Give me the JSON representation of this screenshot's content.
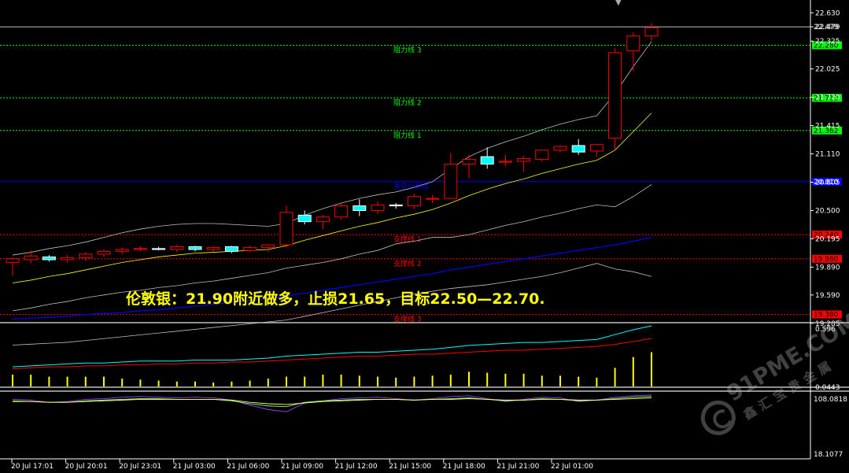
{
  "headline": "伦敦银：21.90附近做多，止损21.65，目标22.50—22.70.",
  "watermark": {
    "brand": "91PME.COM",
    "tagline": "鑫汇宝贵金属"
  },
  "colors": {
    "background": "#000000",
    "axis": "#ffffff",
    "bull_body": "#000000",
    "bull_border": "#ff0000",
    "bear_body": "#00ffff",
    "bear_border": "#ffffff",
    "resistance": "#00ff00",
    "support": "#ff0000",
    "pivot": "#0000ff",
    "ma_fast": "#ffff00",
    "band": "#c0c0c0",
    "blue_ma": "#0000ff",
    "volume_bar": "#ffff00",
    "vol_line_1": "#00ffff",
    "vol_line_2": "#ff0000"
  },
  "chart_data": [
    {
      "type": "candlestick",
      "panel": "price",
      "title": "",
      "ylim": [
        19.3,
        22.7
      ],
      "y_ticks": [
        "22.630",
        "22.479",
        "22.325",
        "22.025",
        "21.720",
        "21.415",
        "21.110",
        "20.805",
        "20.500",
        "20.195",
        "19.890",
        "19.590",
        "19.285"
      ],
      "time_labels": [
        "20 Jul 17:01",
        "20 Jul 20:01",
        "20 Jul 23:01",
        "21 Jul 03:00",
        "21 Jul 06:00",
        "21 Jul 09:00",
        "21 Jul 12:00",
        "21 Jul 15:00",
        "21 Jul 18:00",
        "21 Jul 21:00",
        "22 Jul 01:00"
      ],
      "candles": [
        {
          "o": 19.94,
          "h": 20.0,
          "l": 19.8,
          "c": 19.98
        },
        {
          "o": 19.97,
          "h": 20.07,
          "l": 19.93,
          "c": 20.01
        },
        {
          "o": 20.0,
          "h": 20.02,
          "l": 19.95,
          "c": 19.97
        },
        {
          "o": 19.97,
          "h": 20.02,
          "l": 19.94,
          "c": 19.99
        },
        {
          "o": 19.99,
          "h": 20.05,
          "l": 19.96,
          "c": 20.03
        },
        {
          "o": 20.03,
          "h": 20.08,
          "l": 20.0,
          "c": 20.06
        },
        {
          "o": 20.06,
          "h": 20.1,
          "l": 20.03,
          "c": 20.08
        },
        {
          "o": 20.08,
          "h": 20.11,
          "l": 20.06,
          "c": 20.09
        },
        {
          "o": 20.09,
          "h": 20.11,
          "l": 20.07,
          "c": 20.08
        },
        {
          "o": 20.08,
          "h": 20.13,
          "l": 20.05,
          "c": 20.11
        },
        {
          "o": 20.11,
          "h": 20.12,
          "l": 20.06,
          "c": 20.08
        },
        {
          "o": 20.08,
          "h": 20.11,
          "l": 20.06,
          "c": 20.1
        },
        {
          "o": 20.11,
          "h": 20.12,
          "l": 20.04,
          "c": 20.06
        },
        {
          "o": 20.07,
          "h": 20.12,
          "l": 20.05,
          "c": 20.1
        },
        {
          "o": 20.1,
          "h": 20.14,
          "l": 20.05,
          "c": 20.13
        },
        {
          "o": 20.13,
          "h": 20.55,
          "l": 20.1,
          "c": 20.48
        },
        {
          "o": 20.45,
          "h": 20.5,
          "l": 20.35,
          "c": 20.38
        },
        {
          "o": 20.38,
          "h": 20.45,
          "l": 20.3,
          "c": 20.43
        },
        {
          "o": 20.43,
          "h": 20.58,
          "l": 20.4,
          "c": 20.55
        },
        {
          "o": 20.55,
          "h": 20.62,
          "l": 20.44,
          "c": 20.5
        },
        {
          "o": 20.5,
          "h": 20.6,
          "l": 20.46,
          "c": 20.56
        },
        {
          "o": 20.56,
          "h": 20.58,
          "l": 20.52,
          "c": 20.55
        },
        {
          "o": 20.55,
          "h": 20.68,
          "l": 20.52,
          "c": 20.65
        },
        {
          "o": 20.63,
          "h": 20.67,
          "l": 20.58,
          "c": 20.63
        },
        {
          "o": 20.63,
          "h": 21.12,
          "l": 20.65,
          "c": 21.0
        },
        {
          "o": 21.0,
          "h": 21.1,
          "l": 20.85,
          "c": 21.05
        },
        {
          "o": 21.08,
          "h": 21.18,
          "l": 20.95,
          "c": 21.0
        },
        {
          "o": 21.02,
          "h": 21.1,
          "l": 20.98,
          "c": 21.03
        },
        {
          "o": 21.03,
          "h": 21.09,
          "l": 20.92,
          "c": 21.06
        },
        {
          "o": 21.05,
          "h": 21.15,
          "l": 21.03,
          "c": 21.15
        },
        {
          "o": 21.15,
          "h": 21.2,
          "l": 21.13,
          "c": 21.19
        },
        {
          "o": 21.2,
          "h": 21.27,
          "l": 21.1,
          "c": 21.13
        },
        {
          "o": 21.14,
          "h": 21.22,
          "l": 21.08,
          "c": 21.21
        },
        {
          "o": 21.28,
          "h": 22.25,
          "l": 21.15,
          "c": 22.2
        },
        {
          "o": 22.22,
          "h": 22.42,
          "l": 22.0,
          "c": 22.38
        },
        {
          "o": 22.38,
          "h": 22.52,
          "l": 22.33,
          "c": 22.47
        }
      ],
      "levels": [
        {
          "label": "阻力线 3",
          "value": 22.28,
          "axis_label": "22.280",
          "kind": "resistance"
        },
        {
          "label": "阻力线 2",
          "value": 21.713,
          "axis_label": "21.713",
          "kind": "resistance"
        },
        {
          "label": "阻力线 1",
          "value": 21.362,
          "axis_label": "21.362",
          "kind": "resistance"
        },
        {
          "label": "多空分界线",
          "value": 20.81,
          "axis_label": "20.810",
          "kind": "pivot"
        },
        {
          "label": "支撑线 1",
          "value": 20.24,
          "axis_label": "20.240",
          "kind": "support"
        },
        {
          "label": "支撑线 2",
          "value": 19.98,
          "axis_label": "19.980",
          "kind": "support"
        },
        {
          "label": "支撑线 3",
          "value": 19.38,
          "axis_label": "19.380",
          "kind": "support"
        }
      ],
      "last_price": {
        "value": 22.479,
        "label": "22.479"
      },
      "series": [
        {
          "role": "ma_fast",
          "values": [
            19.72,
            19.75,
            19.79,
            19.82,
            19.86,
            19.9,
            19.94,
            19.97,
            20.0,
            20.02,
            20.04,
            20.05,
            20.06,
            20.07,
            20.08,
            20.12,
            20.18,
            20.23,
            20.28,
            20.33,
            20.37,
            20.42,
            20.46,
            20.51,
            20.58,
            20.66,
            20.73,
            20.79,
            20.84,
            20.9,
            20.95,
            21.0,
            21.04,
            21.15,
            21.35,
            21.55
          ]
        },
        {
          "role": "band_upper",
          "values": [
            20.02,
            20.05,
            20.09,
            20.12,
            20.16,
            20.21,
            20.26,
            20.3,
            20.33,
            20.35,
            20.36,
            20.36,
            20.35,
            20.34,
            20.33,
            20.36,
            20.45,
            20.52,
            20.58,
            20.63,
            20.67,
            20.7,
            20.75,
            20.81,
            20.95,
            21.08,
            21.17,
            21.24,
            21.3,
            21.37,
            21.43,
            21.48,
            21.52,
            21.76,
            22.05,
            22.32
          ]
        },
        {
          "role": "band_lower",
          "values": [
            19.42,
            19.45,
            19.49,
            19.52,
            19.56,
            19.59,
            19.62,
            19.64,
            19.67,
            19.69,
            19.72,
            19.74,
            19.77,
            19.8,
            19.83,
            19.88,
            19.91,
            19.94,
            19.98,
            20.03,
            20.07,
            20.14,
            20.17,
            20.21,
            20.21,
            20.24,
            20.29,
            20.34,
            20.38,
            20.43,
            20.47,
            20.52,
            20.56,
            20.54,
            20.65,
            20.78
          ]
        },
        {
          "role": "blue_ma",
          "values": [
            19.33,
            19.34,
            19.35,
            19.36,
            19.38,
            19.39,
            19.4,
            19.42,
            19.43,
            19.45,
            19.47,
            19.49,
            19.51,
            19.53,
            19.55,
            19.58,
            19.61,
            19.64,
            19.67,
            19.7,
            19.73,
            19.76,
            19.79,
            19.82,
            19.86,
            19.89,
            19.92,
            19.95,
            19.98,
            20.01,
            20.04,
            20.07,
            20.1,
            20.13,
            20.17,
            20.21
          ]
        },
        {
          "role": "lower_envelope",
          "values": [
            19.05,
            19.06,
            19.07,
            19.08,
            19.1,
            19.12,
            19.14,
            19.16,
            19.18,
            19.2,
            19.22,
            19.24,
            19.26,
            19.28,
            19.3,
            19.32,
            19.36,
            19.4,
            19.44,
            19.48,
            19.52,
            19.56,
            19.6,
            19.63,
            19.66,
            19.68,
            19.7,
            19.73,
            19.76,
            19.79,
            19.83,
            19.88,
            19.93,
            19.87,
            19.84,
            19.79
          ]
        }
      ]
    },
    {
      "type": "bar",
      "panel": "volume",
      "y_ticks": [
        "0.596",
        "0.0443"
      ],
      "ylim": [
        0,
        0.62
      ],
      "values": [
        0.12,
        0.12,
        0.1,
        0.1,
        0.1,
        0.1,
        0.08,
        0.07,
        0.06,
        0.05,
        0.05,
        0.04,
        0.05,
        0.06,
        0.08,
        0.1,
        0.1,
        0.12,
        0.12,
        0.11,
        0.1,
        0.09,
        0.1,
        0.11,
        0.12,
        0.15,
        0.14,
        0.13,
        0.13,
        0.11,
        0.11,
        0.1,
        0.09,
        0.19,
        0.3,
        0.35
      ],
      "lines": [
        {
          "role": "vol_line_1",
          "values": [
            0.2,
            0.21,
            0.22,
            0.23,
            0.24,
            0.24,
            0.25,
            0.26,
            0.26,
            0.26,
            0.27,
            0.27,
            0.27,
            0.28,
            0.29,
            0.31,
            0.32,
            0.33,
            0.34,
            0.35,
            0.35,
            0.36,
            0.37,
            0.38,
            0.4,
            0.42,
            0.43,
            0.44,
            0.45,
            0.45,
            0.46,
            0.47,
            0.48,
            0.53,
            0.58,
            0.62
          ]
        },
        {
          "role": "vol_line_2",
          "values": [
            0.18,
            0.19,
            0.2,
            0.2,
            0.21,
            0.21,
            0.22,
            0.22,
            0.23,
            0.23,
            0.24,
            0.24,
            0.25,
            0.25,
            0.26,
            0.27,
            0.28,
            0.29,
            0.3,
            0.31,
            0.31,
            0.32,
            0.33,
            0.33,
            0.34,
            0.35,
            0.36,
            0.37,
            0.37,
            0.38,
            0.39,
            0.4,
            0.41,
            0.43,
            0.46,
            0.49
          ]
        }
      ]
    },
    {
      "type": "line",
      "panel": "oscillator",
      "y_ticks": [
        "108.0818",
        "18.1077"
      ],
      "ylim": [
        18.1077,
        108.0818
      ],
      "series": [
        {
          "role": "osc_purple",
          "values": [
            100,
            99,
            96,
            97,
            100,
            101,
            103,
            104,
            103,
            102,
            103,
            102,
            99,
            92,
            86,
            83,
            95,
            98,
            101,
            102,
            103,
            101,
            99,
            101,
            104,
            105,
            101,
            97,
            100,
            103,
            102,
            97,
            99,
            103,
            105,
            106
          ]
        },
        {
          "role": "osc_green",
          "values": [
            98,
            97,
            96,
            96,
            98,
            99,
            100,
            101,
            101,
            100,
            100,
            100,
            98,
            94,
            91,
            90,
            96,
            98,
            99,
            100,
            100,
            100,
            99,
            100,
            101,
            102,
            100,
            98,
            99,
            101,
            100,
            98,
            99,
            101,
            103,
            104
          ]
        },
        {
          "role": "osc_yellow",
          "values": [
            97,
            97,
            96,
            96,
            97,
            98,
            99,
            100,
            100,
            100,
            100,
            100,
            99,
            96,
            94,
            93,
            95,
            97,
            98,
            99,
            100,
            100,
            99,
            100,
            100,
            101,
            100,
            99,
            99,
            100,
            100,
            99,
            99,
            100,
            101,
            102
          ]
        }
      ]
    }
  ]
}
